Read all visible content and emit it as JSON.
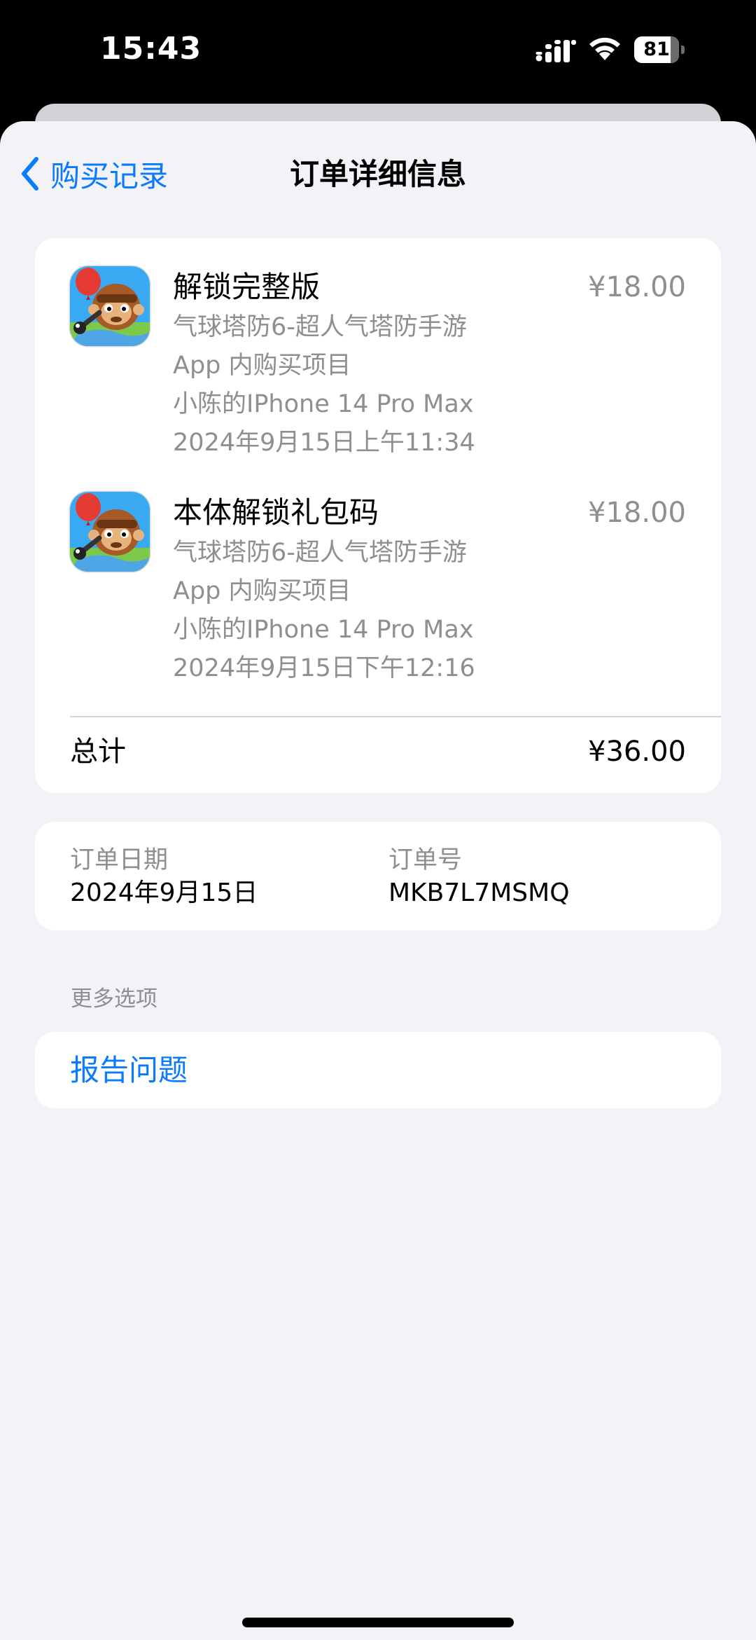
{
  "status_bar": {
    "time": "15:43",
    "battery_level": 81,
    "battery_text": "81",
    "icons": [
      "signal-icon",
      "wifi-icon",
      "battery-icon"
    ]
  },
  "nav": {
    "back_label": "购买记录",
    "title": "订单详细信息"
  },
  "items": [
    {
      "title": "解锁完整版",
      "price": "¥18.00",
      "app_name": "气球塔防6-超人气塔防手游",
      "type": "App 内购买项目",
      "device": "小陈的IPhone 14 Pro Max",
      "datetime": "2024年9月15日上午11:34",
      "icon": "app-icon"
    },
    {
      "title": "本体解锁礼包码",
      "price": "¥18.00",
      "app_name": "气球塔防6-超人气塔防手游",
      "type": "App 内购买项目",
      "device": "小陈的IPhone 14 Pro Max",
      "datetime": "2024年9月15日下午12:16",
      "icon": "app-icon"
    }
  ],
  "total": {
    "label": "总计",
    "value": "¥36.00"
  },
  "order_info": {
    "date_label": "订单日期",
    "date_value": "2024年9月15日",
    "number_label": "订单号",
    "number_value": "MKB7L7MSMQ"
  },
  "more_options": {
    "header": "更多选项",
    "report_label": "报告问题"
  },
  "colors": {
    "accent": "#0a7aff",
    "background": "#f2f2f7",
    "secondary_text": "#8e8e93"
  }
}
